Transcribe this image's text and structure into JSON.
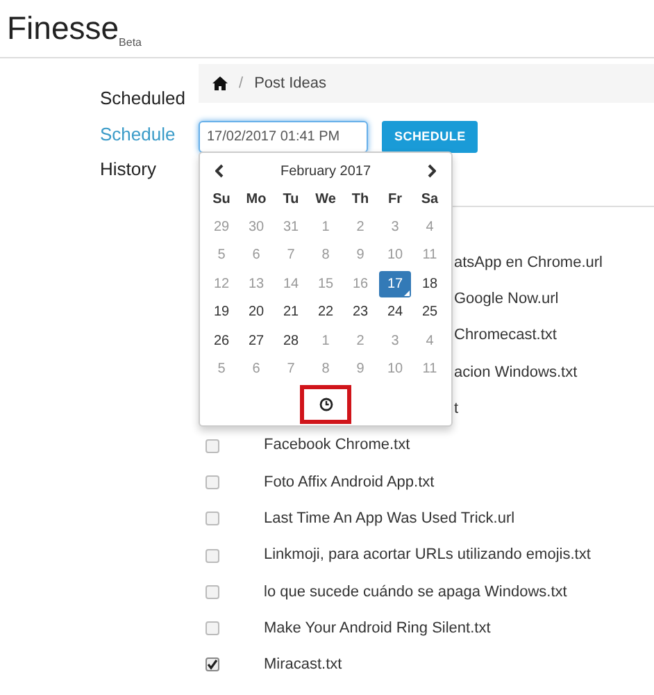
{
  "app": {
    "title": "Finesse",
    "badge": "Beta"
  },
  "nav": [
    {
      "label": "Scheduled",
      "selected": false
    },
    {
      "label": "Schedule",
      "selected": true
    },
    {
      "label": "History",
      "selected": false
    }
  ],
  "breadcrumb": [
    {
      "separator": "/",
      "label": "Post Ideas"
    }
  ],
  "date_field": {
    "value": "17/02/2017 01:41 PM"
  },
  "schedule_button": "SCHEDULE",
  "datepicker": {
    "month": "February 2017",
    "weekdays": [
      "Su",
      "Mo",
      "Tu",
      "We",
      "Th",
      "Fr",
      "Sa"
    ],
    "weeks": [
      [
        {
          "day": "29",
          "disabled": true,
          "selected": false
        },
        {
          "day": "30",
          "disabled": true,
          "selected": false
        },
        {
          "day": "31",
          "disabled": true,
          "selected": false
        },
        {
          "day": "1",
          "disabled": true,
          "selected": false
        },
        {
          "day": "2",
          "disabled": true,
          "selected": false
        },
        {
          "day": "3",
          "disabled": true,
          "selected": false
        },
        {
          "day": "4",
          "disabled": true,
          "selected": false
        }
      ],
      [
        {
          "day": "5",
          "disabled": true,
          "selected": false
        },
        {
          "day": "6",
          "disabled": true,
          "selected": false
        },
        {
          "day": "7",
          "disabled": true,
          "selected": false
        },
        {
          "day": "8",
          "disabled": true,
          "selected": false
        },
        {
          "day": "9",
          "disabled": true,
          "selected": false
        },
        {
          "day": "10",
          "disabled": true,
          "selected": false
        },
        {
          "day": "11",
          "disabled": true,
          "selected": false
        }
      ],
      [
        {
          "day": "12",
          "disabled": true,
          "selected": false
        },
        {
          "day": "13",
          "disabled": true,
          "selected": false
        },
        {
          "day": "14",
          "disabled": true,
          "selected": false
        },
        {
          "day": "15",
          "disabled": true,
          "selected": false
        },
        {
          "day": "16",
          "disabled": true,
          "selected": false
        },
        {
          "day": "17",
          "disabled": false,
          "selected": true
        },
        {
          "day": "18",
          "disabled": false,
          "selected": false
        }
      ],
      [
        {
          "day": "19",
          "disabled": false,
          "selected": false
        },
        {
          "day": "20",
          "disabled": false,
          "selected": false
        },
        {
          "day": "21",
          "disabled": false,
          "selected": false
        },
        {
          "day": "22",
          "disabled": false,
          "selected": false
        },
        {
          "day": "23",
          "disabled": false,
          "selected": false
        },
        {
          "day": "24",
          "disabled": false,
          "selected": false
        },
        {
          "day": "25",
          "disabled": false,
          "selected": false
        }
      ],
      [
        {
          "day": "26",
          "disabled": false,
          "selected": false
        },
        {
          "day": "27",
          "disabled": false,
          "selected": false
        },
        {
          "day": "28",
          "disabled": false,
          "selected": false
        },
        {
          "day": "1",
          "disabled": true,
          "selected": false
        },
        {
          "day": "2",
          "disabled": true,
          "selected": false
        },
        {
          "day": "3",
          "disabled": true,
          "selected": false
        },
        {
          "day": "4",
          "disabled": true,
          "selected": false
        }
      ],
      [
        {
          "day": "5",
          "disabled": true,
          "selected": false
        },
        {
          "day": "6",
          "disabled": true,
          "selected": false
        },
        {
          "day": "7",
          "disabled": true,
          "selected": false
        },
        {
          "day": "8",
          "disabled": true,
          "selected": false
        },
        {
          "day": "9",
          "disabled": true,
          "selected": false
        },
        {
          "day": "10",
          "disabled": true,
          "selected": false
        },
        {
          "day": "11",
          "disabled": true,
          "selected": false
        }
      ]
    ],
    "time_toggle": {
      "highlighted": true
    }
  },
  "files": [
    {
      "kind": "cut",
      "name": "atsApp en Chrome.url"
    },
    {
      "kind": "cut",
      "name": "Google Now.url"
    },
    {
      "kind": "cut",
      "name": "Chromecast.txt"
    },
    {
      "kind": "cut",
      "name": "acion Windows.txt"
    },
    {
      "kind": "cut",
      "name": "t"
    },
    {
      "kind": "file",
      "name": "Facebook Chrome.txt",
      "checked": false
    },
    {
      "kind": "file",
      "name": "Foto Affix Android App.txt",
      "checked": false
    },
    {
      "kind": "file",
      "name": "Last Time An App Was Used Trick.url",
      "checked": false
    },
    {
      "kind": "file",
      "name": "Linkmoji, para acortar URLs utilizando emojis.txt",
      "checked": false
    },
    {
      "kind": "file",
      "name": "lo que sucede cuándo se apaga Windows.txt",
      "checked": false
    },
    {
      "kind": "file",
      "name": "Make Your Android Ring Silent.txt",
      "checked": false
    },
    {
      "kind": "file",
      "name": "Miracast.txt",
      "checked": true
    }
  ]
}
